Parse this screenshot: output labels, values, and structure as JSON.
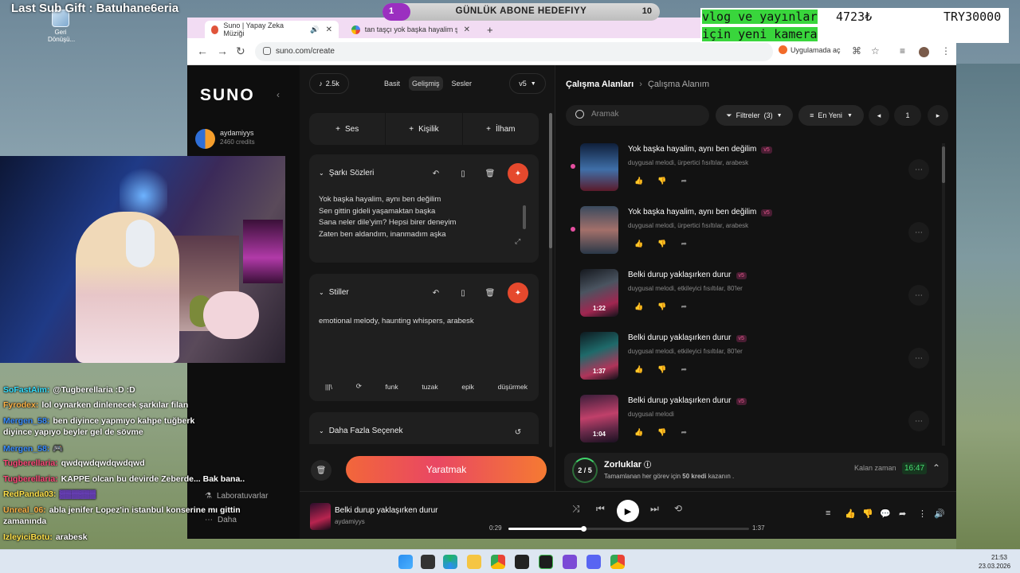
{
  "overlay": {
    "last_sub": "Last Sub Gift : Batuhane6eria",
    "goal": {
      "current": "1",
      "label": "GÜNLÜK ABONE HEDEFIYY",
      "target": "10",
      "progress": 0.1
    },
    "donation": {
      "line1": "vlog ve yayınlar",
      "line2": "için yeni kamera",
      "amount": "4723₺",
      "goal": "TRY30000"
    }
  },
  "desktop": {
    "recycle_label": "Geri Dönüşü..."
  },
  "browser": {
    "tabs": [
      {
        "label": "Suno | Yapay Zeka Müziği",
        "close": "✕"
      },
      {
        "label": "tan taşçı yok başka hayalim şarkı s",
        "close": "✕"
      },
      {
        "label": "+"
      }
    ],
    "url": "suno.com/create",
    "open_in_app": "Uygulamada aç"
  },
  "sidebar": {
    "logo": "SUNO",
    "user": {
      "name": "aydamiyys",
      "credits": "2460 credits"
    },
    "items": [
      {
        "label": "Laboratuvarlar",
        "icon": "flask-icon"
      },
      {
        "label": "Daha",
        "icon": "more-icon"
      }
    ]
  },
  "create": {
    "count": "2.5k",
    "modes": [
      "Basit",
      "Gelişmiş",
      "Sesler"
    ],
    "version": "v5",
    "add_buttons": [
      "Ses",
      "Kişilik",
      "İlham"
    ],
    "lyrics": {
      "title": "Şarkı Sözleri",
      "lines": [
        "Yok başka hayalim, aynı ben değilim",
        "Sen gittin gideli yaşamaktan başka",
        "Sana neler dile'yim? Hepsi birer deneyim",
        "Zaten ben aldandım, inanmadım aşka"
      ]
    },
    "styles": {
      "title": "Stiller",
      "value": "emotional melody, haunting whispers, arabesk",
      "tags": [
        "funk",
        "tuzak",
        "epik",
        "düşürmek"
      ]
    },
    "more_options": "Daha Fazla Seçenek",
    "create_button": "Yaratmak"
  },
  "workspace": {
    "breadcrumb": {
      "root": "Çalışma Alanları",
      "current": "Çalışma Alanım"
    },
    "search_placeholder": "Aramak",
    "filters": "Filtreler",
    "filter_count": "(3)",
    "sort": "En Yeni",
    "page": "1",
    "songs": [
      {
        "title": "Yok başka hayalim, aynı ben değilim",
        "badge": "v5",
        "desc": "duygusal melodi, ürpertici fısıltılar, arabesk",
        "duration": "",
        "new": true
      },
      {
        "title": "Yok başka hayalim, aynı ben değilim",
        "badge": "v5",
        "desc": "duygusal melodi, ürpertici fısıltılar, arabesk",
        "duration": "",
        "new": true
      },
      {
        "title": "Belki durup yaklaşırken durur",
        "badge": "v5",
        "desc": "duygusal melodi, etkileyici fısıltılar, 80'ler",
        "duration": "1:22",
        "new": false
      },
      {
        "title": "Belki durup yaklaşırken durur",
        "badge": "v5",
        "desc": "duygusal melodi, etkileyici fısıltılar, 80'ler",
        "duration": "1:37",
        "new": false
      },
      {
        "title": "Belki durup yaklaşırken durur",
        "badge": "v5",
        "desc": "duygusal melodi",
        "duration": "1:04",
        "new": false
      }
    ],
    "challenges": {
      "progress": "2 / 5",
      "title": "Zorluklar",
      "subtitle_prefix": "Tamamlanan her görev için",
      "subtitle_bold": "50 kredi",
      "subtitle_suffix": "kazanın .",
      "time_label": "Kalan zaman",
      "time": "16:47"
    }
  },
  "player": {
    "title": "Belki durup yaklaşırken durur",
    "user": "aydamiyys",
    "elapsed": "0:29",
    "total": "1:37",
    "progress": 0.31
  },
  "chat": [
    {
      "user": "SoFastAim:",
      "color": "#35e0ff",
      "text": "@Tugberellaria :D :D"
    },
    {
      "user": "Fyrodex:",
      "color": "#ffb347",
      "text": "lol oynarken dinlenecek şarkılar filan"
    },
    {
      "user": "Mergen_58:",
      "color": "#3a8dff",
      "text": "ben diyince yapmıyo kahpe tuğberk"
    },
    {
      "user": "",
      "color": "#ffffff",
      "text": "diyince yapıyo beyler gel de sövme"
    },
    {
      "user": "Mergen_58:",
      "color": "#3a8dff",
      "text": "🎮"
    },
    {
      "user": "Tugberellaria:",
      "color": "#ff4a7a",
      "text": "qwdqwdqwdqwdqwd"
    },
    {
      "user": "Tugberellaria:",
      "color": "#ff4a7a",
      "text": "KAPPE olcan bu devirde Zeberde... Bak bana.."
    },
    {
      "user": "RedPanda03:",
      "color": "#ffe14a",
      "text": "▓▓▓▓▓▓"
    },
    {
      "user": "Unreal_06:",
      "color": "#ffb347",
      "text": "abla jenifer Lopez'in istanbul konserine mı gittin"
    },
    {
      "user": "",
      "color": "#ffffff",
      "text": "zamanında"
    },
    {
      "user": "IzleyiciBotu:",
      "color": "#ffe14a",
      "text": "arabesk"
    }
  ],
  "taskbar": {
    "time": "21:53",
    "date": "23.03.2026"
  }
}
